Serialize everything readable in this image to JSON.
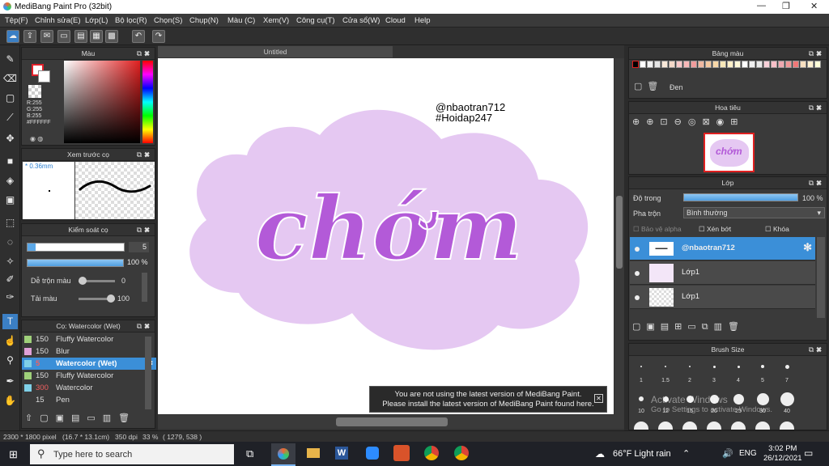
{
  "window": {
    "title": "MediBang Paint Pro (32bit)",
    "min": "—",
    "max": "❐",
    "close": "✕"
  },
  "menu": [
    "Tệp(F)",
    "Chỉnh sửa(E)",
    "Lớp(L)",
    "Bộ lọc(R)",
    "Chọn(S)",
    "Chụp(N)",
    "Màu (C)",
    "Xem(V)",
    "Công cụ(T)",
    "Cửa sổ(W)",
    "Cloud",
    "Help"
  ],
  "color_panel": {
    "title": "Màu",
    "r": "R:255",
    "g": "G:255",
    "b": "B:255",
    "hex": "#FFFFFF",
    "fg": "#e0202a",
    "bg": "#ffffff"
  },
  "preview_panel": {
    "title": "Xem trước cọ",
    "size": "* 0.36mm"
  },
  "brush_control": {
    "title": "Kiểm soát cọ",
    "size_value": "5",
    "opacity_value": "100 %",
    "blend_label": "Dễ trộn màu",
    "blend_value": "0",
    "load_label": "Tải màu",
    "load_value": "100"
  },
  "brush_list": {
    "title": "Cọ: Watercolor (Wet)",
    "items": [
      {
        "size": "150",
        "name": "Fluffy Watercolor",
        "color": "#9fd07a"
      },
      {
        "size": "150",
        "name": "Blur",
        "color": "#e0a0d8"
      },
      {
        "size": "5",
        "name": "Watercolor (Wet)",
        "color": "#7fd0e8"
      },
      {
        "size": "150",
        "name": "Fluffy Watercolor",
        "color": "#9fd07a"
      },
      {
        "size": "300",
        "name": "Watercolor",
        "color": "#7fd0e8"
      },
      {
        "size": "15",
        "name": "Pen",
        "color": "#3a3a3a"
      }
    ]
  },
  "canvas": {
    "tab": "Untitled",
    "lettering": "chớm",
    "watermark_line1": "@nbaotran712",
    "watermark_line2": "#Hoidap247"
  },
  "notice": {
    "line1": "You are not using the latest version of MediBang Paint.",
    "line2": "Please install the latest version of MediBang Paint found here.",
    "close": "✕"
  },
  "palette": {
    "title": "Bảng màu",
    "current": "Đen",
    "colors": [
      "#000000",
      "#ffffff",
      "#f2f2f2",
      "#e6e6e6",
      "#f8e8d8",
      "#f4d8c8",
      "#f8c8c8",
      "#f8b8b8",
      "#f09c9c",
      "#f0b8a0",
      "#f4c8a0",
      "#f8d8a8",
      "#f8e8b8",
      "#fff0c8",
      "#fff8d8",
      "#ffffff",
      "#f0f0f0",
      "#e8e8e8",
      "#f8d0d8",
      "#f8c0c8",
      "#f0a8b0",
      "#f09898",
      "#f07878",
      "#f8e0c0",
      "#fff0d0",
      "#ffffd8"
    ]
  },
  "navigator": {
    "title": "Hoa tiêu"
  },
  "layer_panel": {
    "title": "Lớp",
    "opacity_label": "Độ trong",
    "opacity_value": "100 %",
    "blend_label": "Pha trộn",
    "blend_value": "Bình thường",
    "protect_alpha": "Bảo vệ alpha",
    "clipping": "Xén bớt",
    "lock": "Khóa",
    "layers": [
      {
        "name": "@nbaotran712"
      },
      {
        "name": "Lớp1"
      },
      {
        "name": "Lớp1"
      }
    ]
  },
  "brush_size": {
    "title": "Brush Size",
    "row1": [
      "1",
      "1.5",
      "2",
      "3",
      "4",
      "5",
      "7"
    ],
    "row2": [
      "10",
      "12",
      "15",
      "20",
      "25",
      "30",
      "40"
    ]
  },
  "statusbar": {
    "dims": "2300 * 1800 pixel",
    "cm": "(16.7 * 13.1cm)",
    "dpi": "350 dpi",
    "zoom": "33 %",
    "coords": "( 1279, 538 )"
  },
  "activation": {
    "line1": "Activate Windows",
    "line2": "Go to Settings to activate Windows."
  },
  "taskbar": {
    "search": "Type here to search",
    "weather": "66°F  Light rain",
    "lang": "ENG",
    "time": "3:02 PM",
    "date": "26/12/2021"
  }
}
